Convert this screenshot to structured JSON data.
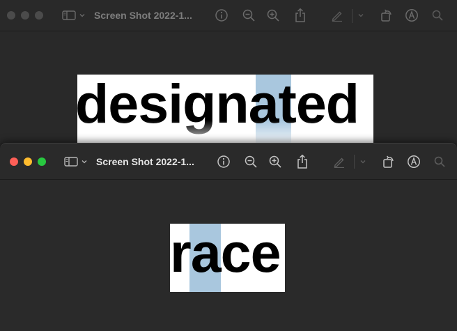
{
  "back_window": {
    "title": "Screen Shot 2022-1...",
    "image_word": "designated",
    "active": false
  },
  "front_window": {
    "title": "Screen Shot 2022-1...",
    "image_word": "race",
    "active": true
  },
  "colors": {
    "highlight": "#a9c7de",
    "close": "#fe5f57",
    "minimize": "#febc2e",
    "maximize": "#28c840"
  },
  "icons": [
    "sidebar-icon",
    "chevron-down-icon",
    "info-icon",
    "zoom-out-icon",
    "zoom-in-icon",
    "share-icon",
    "markup-pen-icon",
    "rotate-icon",
    "markup-icon",
    "search-icon"
  ]
}
